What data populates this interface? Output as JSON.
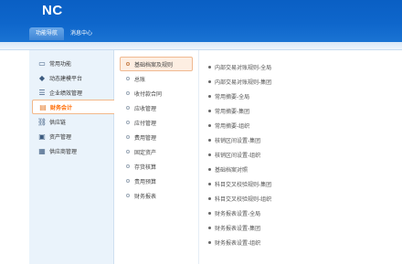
{
  "header": {
    "logo": "NC",
    "tabs": [
      {
        "label": "功能导航",
        "active": true
      },
      {
        "label": "消息中心",
        "active": false
      }
    ]
  },
  "sidebar": {
    "items": [
      {
        "label": "常用功能",
        "icon": "monitor-icon",
        "glyph": "▭"
      },
      {
        "label": "动态建模平台",
        "icon": "cube-icon",
        "glyph": "◆"
      },
      {
        "label": "企业绩效管理",
        "icon": "list-icon",
        "glyph": "☰"
      },
      {
        "label": "财务会计",
        "icon": "book-icon",
        "glyph": "▤",
        "active": true
      },
      {
        "label": "供应链",
        "icon": "link-icon",
        "glyph": "⛓"
      },
      {
        "label": "资产管理",
        "icon": "asset-icon",
        "glyph": "▣"
      },
      {
        "label": "供应商管理",
        "icon": "supplier-icon",
        "glyph": "▦"
      }
    ]
  },
  "submenu": {
    "items": [
      {
        "label": "基础档案及规则",
        "active": true
      },
      {
        "label": "总账"
      },
      {
        "label": "收付款合同"
      },
      {
        "label": "应收管理"
      },
      {
        "label": "应付管理"
      },
      {
        "label": "费用管理"
      },
      {
        "label": "固定资产"
      },
      {
        "label": "存货核算"
      },
      {
        "label": "责用预算"
      },
      {
        "label": "财务报表"
      }
    ]
  },
  "links": {
    "items": [
      "内部交易对账规则-全局",
      "内部交易对账规则-集团",
      "常用摘要-全局",
      "常用摘要-集团",
      "常用摘要-组织",
      "核销区间设置-集团",
      "核销区间设置-组织",
      "基础档案对照",
      "科目交叉校验规则-集团",
      "科目交叉校验规则-组织",
      "财务报表设置-全局",
      "财务报表设置-集团",
      "财务报表设置-组织"
    ]
  },
  "colors": {
    "header_blue": "#0e66cb",
    "accent_orange": "#ff6a00",
    "sidebar_bg": "#eaf3fb"
  }
}
